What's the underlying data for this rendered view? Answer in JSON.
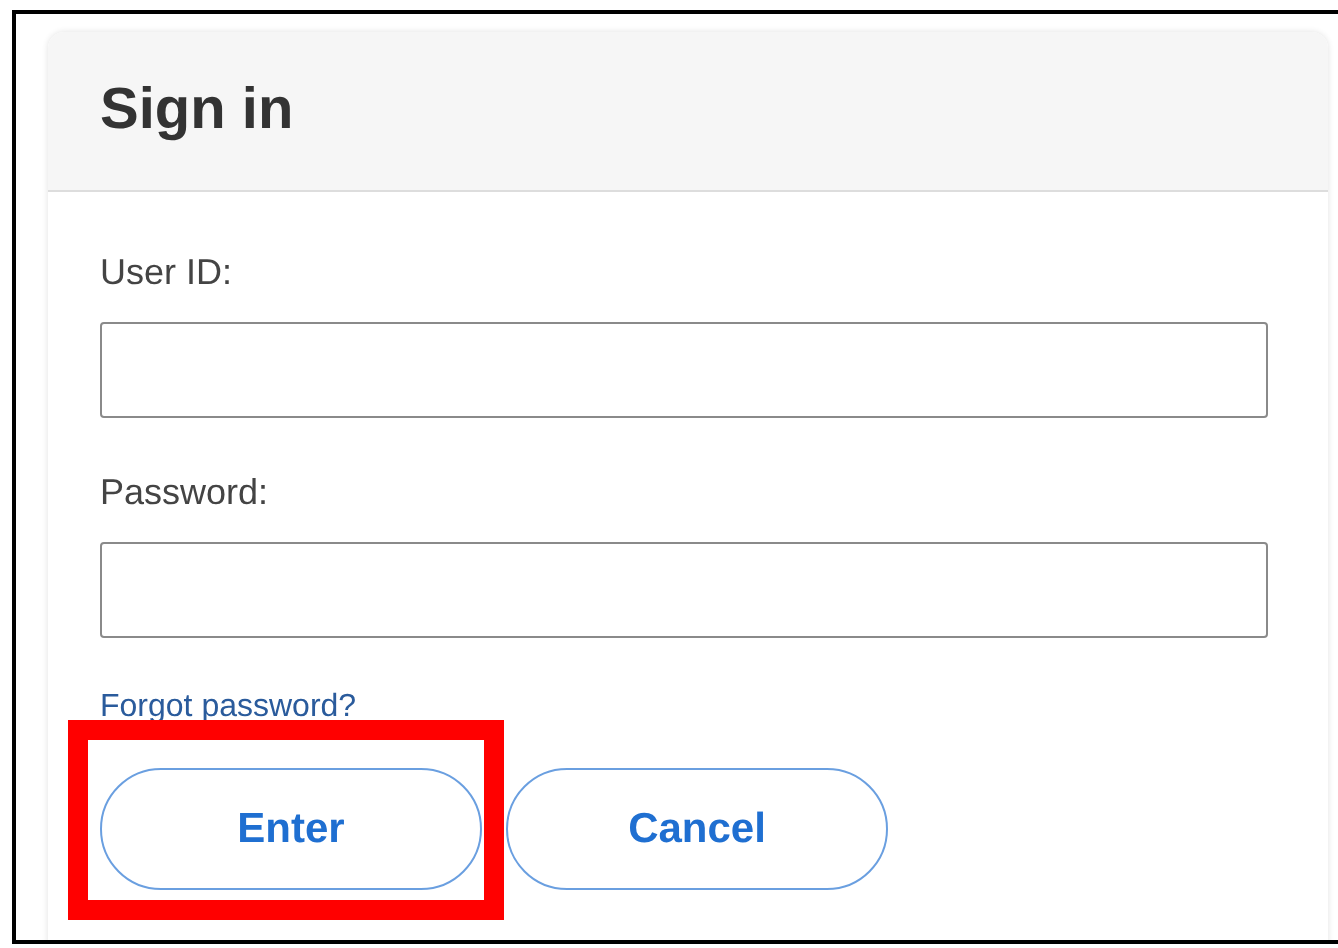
{
  "title": "Sign in",
  "fields": [
    {
      "label": "User ID:"
    },
    {
      "label": "Password:"
    }
  ],
  "link": "Forgot password?",
  "buttons": [
    {
      "label": "Enter",
      "highlighted": true
    },
    {
      "label": "Cancel",
      "highlighted": false
    }
  ]
}
